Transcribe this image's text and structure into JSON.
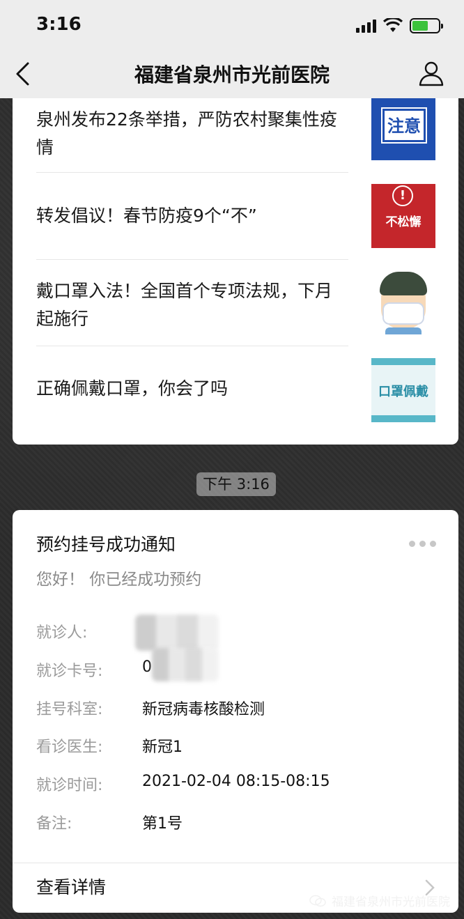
{
  "status": {
    "time": "3:16"
  },
  "nav": {
    "title": "福建省泉州市光前医院"
  },
  "news": [
    {
      "title": "泉州发布22条举措，严防农村聚集性疫情",
      "thumb_text": "注意"
    },
    {
      "title": "转发倡议！春节防疫9个“不”",
      "thumb_text": "不松懈"
    },
    {
      "title": "戴口罩入法！全国首个专项法规，下月起施行",
      "thumb_text": ""
    },
    {
      "title": "正确佩戴口罩，你会了吗",
      "thumb_text": "口罩佩戴"
    }
  ],
  "chip": {
    "time": "下午 3:16"
  },
  "notice": {
    "title": "预约挂号成功通知",
    "subtitle": "您好！ 你已经成功预约",
    "fields": [
      {
        "label": "就诊人:",
        "value": ""
      },
      {
        "label": "就诊卡号:",
        "value": "0"
      },
      {
        "label": "挂号科室:",
        "value": "新冠病毒核酸检测"
      },
      {
        "label": "看诊医生:",
        "value": "新冠1"
      },
      {
        "label": "就诊时间:",
        "value": "2021-02-04 08:15-08:15"
      },
      {
        "label": "备注:",
        "value": "第1号"
      }
    ],
    "detail_label": "查看详情"
  },
  "watermark": {
    "text": "福建省泉州市光前医院"
  },
  "colors": {
    "nav_bg": "#ededed",
    "card_bg": "#ffffff",
    "muted": "#9a9a9a"
  },
  "icons": [
    "back-arrow-icon",
    "user-profile-icon",
    "more-dots-icon",
    "chevron-right-icon",
    "wechat-icon"
  ]
}
